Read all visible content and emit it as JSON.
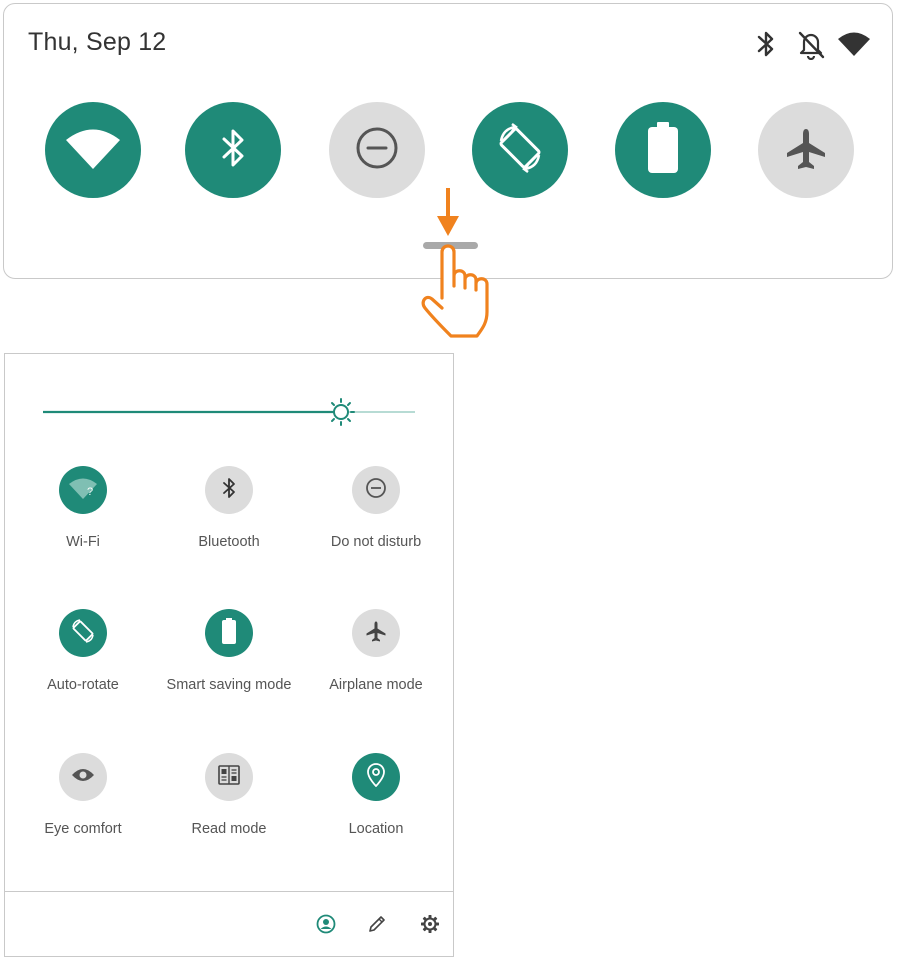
{
  "top_panel": {
    "date": "Thu, Sep 12",
    "status_icons": [
      "bluetooth-icon",
      "bell-off-icon",
      "wifi-icon"
    ],
    "toggles": [
      {
        "icon": "wifi-icon",
        "state": "on"
      },
      {
        "icon": "bluetooth-icon",
        "state": "on"
      },
      {
        "icon": "do-not-disturb-icon",
        "state": "off"
      },
      {
        "icon": "auto-rotate-icon",
        "state": "on"
      },
      {
        "icon": "battery-icon",
        "state": "on"
      },
      {
        "icon": "airplane-icon",
        "state": "off"
      }
    ]
  },
  "expanded_panel": {
    "brightness_level": 0.8,
    "tiles": [
      {
        "label": "Wi-Fi",
        "icon": "wifi-icon",
        "state": "on"
      },
      {
        "label": "Bluetooth",
        "icon": "bluetooth-icon",
        "state": "off"
      },
      {
        "label": "Do not disturb",
        "icon": "do-not-disturb-icon",
        "state": "off"
      },
      {
        "label": "Auto-rotate",
        "icon": "auto-rotate-icon",
        "state": "on"
      },
      {
        "label": "Smart saving mode",
        "icon": "battery-icon",
        "state": "on"
      },
      {
        "label": "Airplane mode",
        "icon": "airplane-icon",
        "state": "off"
      },
      {
        "label": "Eye comfort",
        "icon": "eye-icon",
        "state": "off"
      },
      {
        "label": "Read mode",
        "icon": "read-mode-icon",
        "state": "off"
      },
      {
        "label": "Location",
        "icon": "location-icon",
        "state": "on"
      }
    ],
    "footer_icons": [
      "user-icon",
      "edit-icon",
      "settings-icon"
    ]
  },
  "colors": {
    "accent": "#1f8a78",
    "toggle_off": "#dcdcdc",
    "gesture": "#f0821e"
  }
}
